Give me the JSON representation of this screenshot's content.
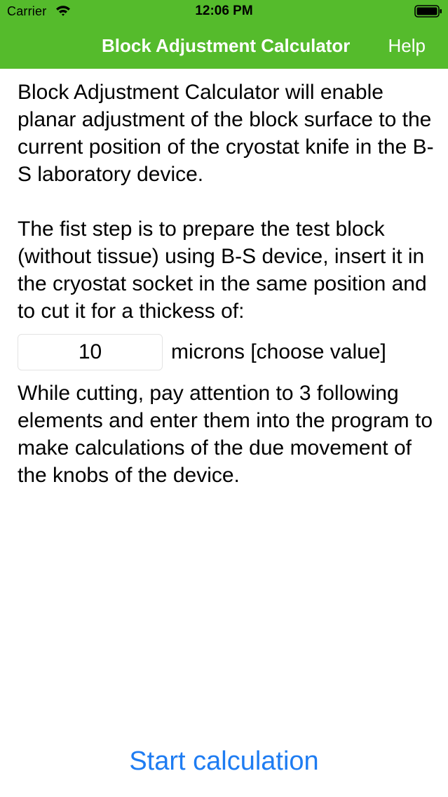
{
  "status_bar": {
    "carrier": "Carrier",
    "time": "12:06 PM",
    "wifi_icon": "wifi-icon",
    "battery_icon": "battery-full-icon"
  },
  "nav": {
    "title": "Block Adjustment Calculator",
    "help_label": "Help"
  },
  "content": {
    "intro": "Block Adjustment Calculator will enable planar adjustment of the block surface to the current position of the cryostat knife in the B-S laboratory device.",
    "step": "The fist step is to prepare the test block (without tissue) using B-S device, insert it in the cryostat socket in the same position and to cut it for a thickess of:",
    "thickness_value": "10",
    "thickness_unit": "microns [choose value]",
    "instructions": "While cutting, pay attention to 3 following elements and enter them into the program to make calculations of the due movement of the knobs of the device."
  },
  "actions": {
    "start_label": "Start calculation"
  },
  "colors": {
    "nav_background": "#55bb2c",
    "nav_text": "#ffffff",
    "button_text": "#1e7cf2",
    "body_text": "#000000"
  }
}
